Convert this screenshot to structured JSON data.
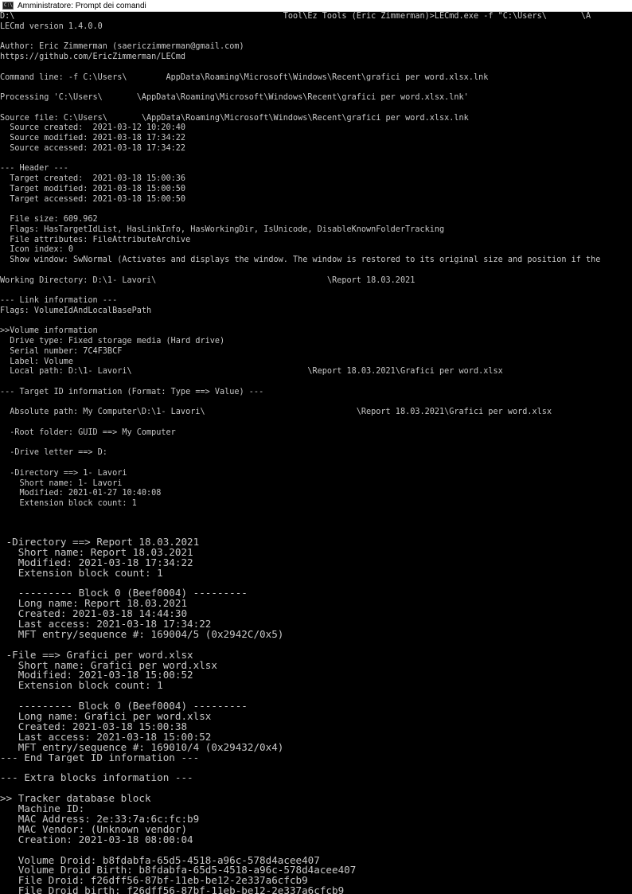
{
  "window": {
    "title": "Amministratore: Prompt dei comandi",
    "icon_text": "C:\\"
  },
  "colors": {
    "background": "#000000",
    "text": "#c8c8c8",
    "magenta": "#d63ad6",
    "yellow": "#dede2a"
  },
  "console": {
    "section1": [
      {
        "t": "D:\\                                                       Tool\\Ez Tools (Eric Zimmerman)>LECmd.exe -f \"C:\\Users\\       \\A",
        "c": "g"
      },
      {
        "t": "LECmd version 1.4.0.0",
        "c": "g"
      },
      {
        "t": "",
        "c": "g"
      },
      {
        "t": "Author: Eric Zimmerman (saericzimmerman@gmail.com)",
        "c": "g"
      },
      {
        "t": "https://github.com/EricZimmerman/LECmd",
        "c": "g"
      },
      {
        "t": "",
        "c": "g"
      },
      {
        "t": "Command line: -f C:\\Users\\        AppData\\Roaming\\Microsoft\\Windows\\Recent\\grafici per word.xlsx.lnk",
        "c": "g"
      },
      {
        "t": "",
        "c": "g"
      },
      {
        "t": "Processing 'C:\\Users\\       \\AppData\\Roaming\\Microsoft\\Windows\\Recent\\grafici per word.xlsx.lnk'",
        "c": "m"
      },
      {
        "t": "",
        "c": "g"
      },
      {
        "t": "Source file: C:\\Users\\       \\AppData\\Roaming\\Microsoft\\Windows\\Recent\\grafici per word.xlsx.lnk",
        "c": "y"
      },
      {
        "t": "  Source created:  2021-03-12 10:20:40",
        "c": "g"
      },
      {
        "t": "  Source modified: 2021-03-18 17:34:22",
        "c": "g"
      },
      {
        "t": "  Source accessed: 2021-03-18 17:34:22",
        "c": "g"
      },
      {
        "t": "",
        "c": "g"
      },
      {
        "t": "--- Header ---",
        "c": "m"
      },
      {
        "t": "  Target created:  2021-03-18 15:00:36",
        "c": "g"
      },
      {
        "t": "  Target modified: 2021-03-18 15:00:50",
        "c": "g"
      },
      {
        "t": "  Target accessed: 2021-03-18 15:00:50",
        "c": "g"
      },
      {
        "t": "",
        "c": "g"
      },
      {
        "t": "  File size: 609.962",
        "c": "g"
      },
      {
        "t": "  Flags: HasTargetIdList, HasLinkInfo, HasWorkingDir, IsUnicode, DisableKnownFolderTracking",
        "c": "g"
      },
      {
        "t": "  File attributes: FileAttributeArchive",
        "c": "g"
      },
      {
        "t": "  Icon index: 0",
        "c": "g"
      },
      {
        "t": "  Show window: SwNormal (Activates and displays the window. The window is restored to its original size and position if the",
        "c": "g"
      },
      {
        "t": "",
        "c": "g"
      },
      {
        "t": "Working Directory: D:\\1- Lavori\\                                   \\Report 18.03.2021",
        "c": "g"
      },
      {
        "t": "",
        "c": "g"
      },
      {
        "t": "--- Link information ---",
        "c": "y"
      },
      {
        "t": "Flags: VolumeIdAndLocalBasePath",
        "c": "g"
      },
      {
        "t": "",
        "c": "g"
      },
      {
        "t": ">>Volume information",
        "c": "m"
      },
      {
        "t": "  Drive type: Fixed storage media (Hard drive)",
        "c": "g"
      },
      {
        "t": "  Serial number: 7C4F3BCF",
        "c": "g"
      },
      {
        "t": "  Label: Volume",
        "c": "g"
      },
      {
        "t": "  Local path: D:\\1- Lavori\\                                    \\Report 18.03.2021\\Grafici per word.xlsx",
        "c": "g"
      },
      {
        "t": "",
        "c": "g"
      },
      {
        "t": "--- Target ID information (Format: Type ==> Value) ---",
        "c": "y"
      },
      {
        "t": "",
        "c": "g"
      },
      {
        "t": "  Absolute path: My Computer\\D:\\1- Lavori\\                               \\Report 18.03.2021\\Grafici per word.xlsx",
        "c": "g"
      },
      {
        "t": "",
        "c": "g"
      },
      {
        "t": "  -Root folder: GUID ==> My Computer",
        "c": "g"
      },
      {
        "t": "",
        "c": "g"
      },
      {
        "t": "  -Drive letter ==> D:",
        "c": "g"
      },
      {
        "t": "",
        "c": "g"
      },
      {
        "t": "  -Directory ==> 1- Lavori",
        "c": "g"
      },
      {
        "t": "    Short name: 1- Lavori",
        "c": "g"
      },
      {
        "t": "    Modified: 2021-01-27 10:40:08",
        "c": "g"
      },
      {
        "t": "    Extension block count: 1",
        "c": "g"
      }
    ],
    "section2": [
      {
        "t": "",
        "c": "g"
      },
      {
        "t": " -Directory ==> Report 18.03.2021",
        "c": "g"
      },
      {
        "t": "   Short name: Report 18.03.2021",
        "c": "g"
      },
      {
        "t": "   Modified: 2021-03-18 17:34:22",
        "c": "g"
      },
      {
        "t": "   Extension block count: 1",
        "c": "g"
      },
      {
        "t": "",
        "c": "g"
      },
      {
        "t": "   --------- Block 0 (Beef0004) ---------",
        "c": "g"
      },
      {
        "t": "   Long name: Report 18.03.2021",
        "c": "g"
      },
      {
        "t": "   Created: 2021-03-18 14:44:30",
        "c": "g"
      },
      {
        "t": "   Last access: 2021-03-18 17:34:22",
        "c": "g"
      },
      {
        "t": "   MFT entry/sequence #: 169004/5 (0x2942C/0x5)",
        "c": "g"
      },
      {
        "t": "",
        "c": "g"
      },
      {
        "t": " -File ==> Grafici per word.xlsx",
        "c": "g"
      },
      {
        "t": "   Short name: Grafici per word.xlsx",
        "c": "g"
      },
      {
        "t": "   Modified: 2021-03-18 15:00:52",
        "c": "g"
      },
      {
        "t": "   Extension block count: 1",
        "c": "g"
      },
      {
        "t": "",
        "c": "g"
      },
      {
        "t": "   --------- Block 0 (Beef0004) ---------",
        "c": "g"
      },
      {
        "t": "   Long name: Grafici per word.xlsx",
        "c": "g"
      },
      {
        "t": "   Created: 2021-03-18 15:00:38",
        "c": "g"
      },
      {
        "t": "   Last access: 2021-03-18 15:00:52",
        "c": "g"
      },
      {
        "t": "   MFT entry/sequence #: 169010/4 (0x29432/0x4)",
        "c": "g"
      },
      {
        "t": "--- End Target ID information ---",
        "c": "y"
      },
      {
        "t": "",
        "c": "g"
      },
      {
        "t": "--- Extra blocks information ---",
        "c": "y"
      },
      {
        "t": "",
        "c": "g"
      },
      {
        "t": ">> Tracker database block",
        "c": "m"
      },
      {
        "t": "   Machine ID:",
        "c": "g"
      },
      {
        "t": "   MAC Address: 2e:33:7a:6c:fc:b9",
        "c": "g"
      },
      {
        "t": "   MAC Vendor: (Unknown vendor)",
        "c": "g"
      },
      {
        "t": "   Creation: 2021-03-18 08:00:04",
        "c": "g"
      },
      {
        "t": "",
        "c": "g"
      },
      {
        "t": "   Volume Droid: b8fdabfa-65d5-4518-a96c-578d4acee407",
        "c": "g"
      },
      {
        "t": "   Volume Droid Birth: b8fdabfa-65d5-4518-a96c-578d4acee407",
        "c": "g"
      },
      {
        "t": "   File Droid: f26dff56-87bf-11eb-be12-2e337a6cfcb9",
        "c": "g"
      },
      {
        "t": "   File Droid birth: f26dff56-87bf-11eb-be12-2e337a6cfcb9",
        "c": "g"
      }
    ]
  }
}
